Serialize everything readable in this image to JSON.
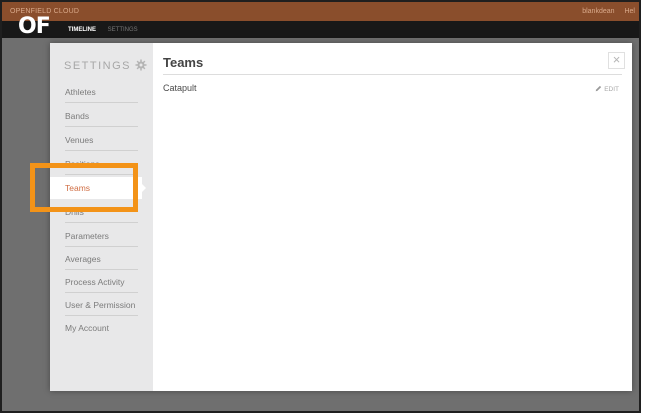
{
  "topbar": {
    "brand": "OPENFIELD CLOUD",
    "user": "blankdean",
    "help": "Hel"
  },
  "navbar": {
    "logo": "OF",
    "timeline": "TIMELINE",
    "settings": "SETTINGS"
  },
  "sidebar": {
    "title": "SETTINGS",
    "items": [
      {
        "label": "Athletes"
      },
      {
        "label": "Bands"
      },
      {
        "label": "Venues"
      },
      {
        "label": "Positions"
      },
      {
        "label": "Teams",
        "active": true
      },
      {
        "label": "Drills"
      },
      {
        "label": "Parameters"
      },
      {
        "label": "Averages"
      },
      {
        "label": "Process Activity"
      },
      {
        "label": "User & Permission"
      },
      {
        "label": "My Account"
      }
    ]
  },
  "content": {
    "title": "Teams",
    "close_symbol": "×",
    "rows": [
      {
        "name": "Catapult",
        "edit_label": "EDIT"
      }
    ]
  },
  "colors": {
    "accent": "#d06e44",
    "highlight": "#f39318",
    "topbar": "#8a4e2c"
  }
}
